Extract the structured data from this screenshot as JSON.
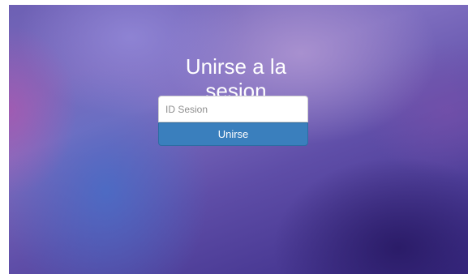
{
  "join": {
    "title_line1": "Unirse a la",
    "title_line2": "sesion",
    "input_placeholder": "ID Sesion",
    "input_value": "",
    "button_label": "Unirse"
  }
}
